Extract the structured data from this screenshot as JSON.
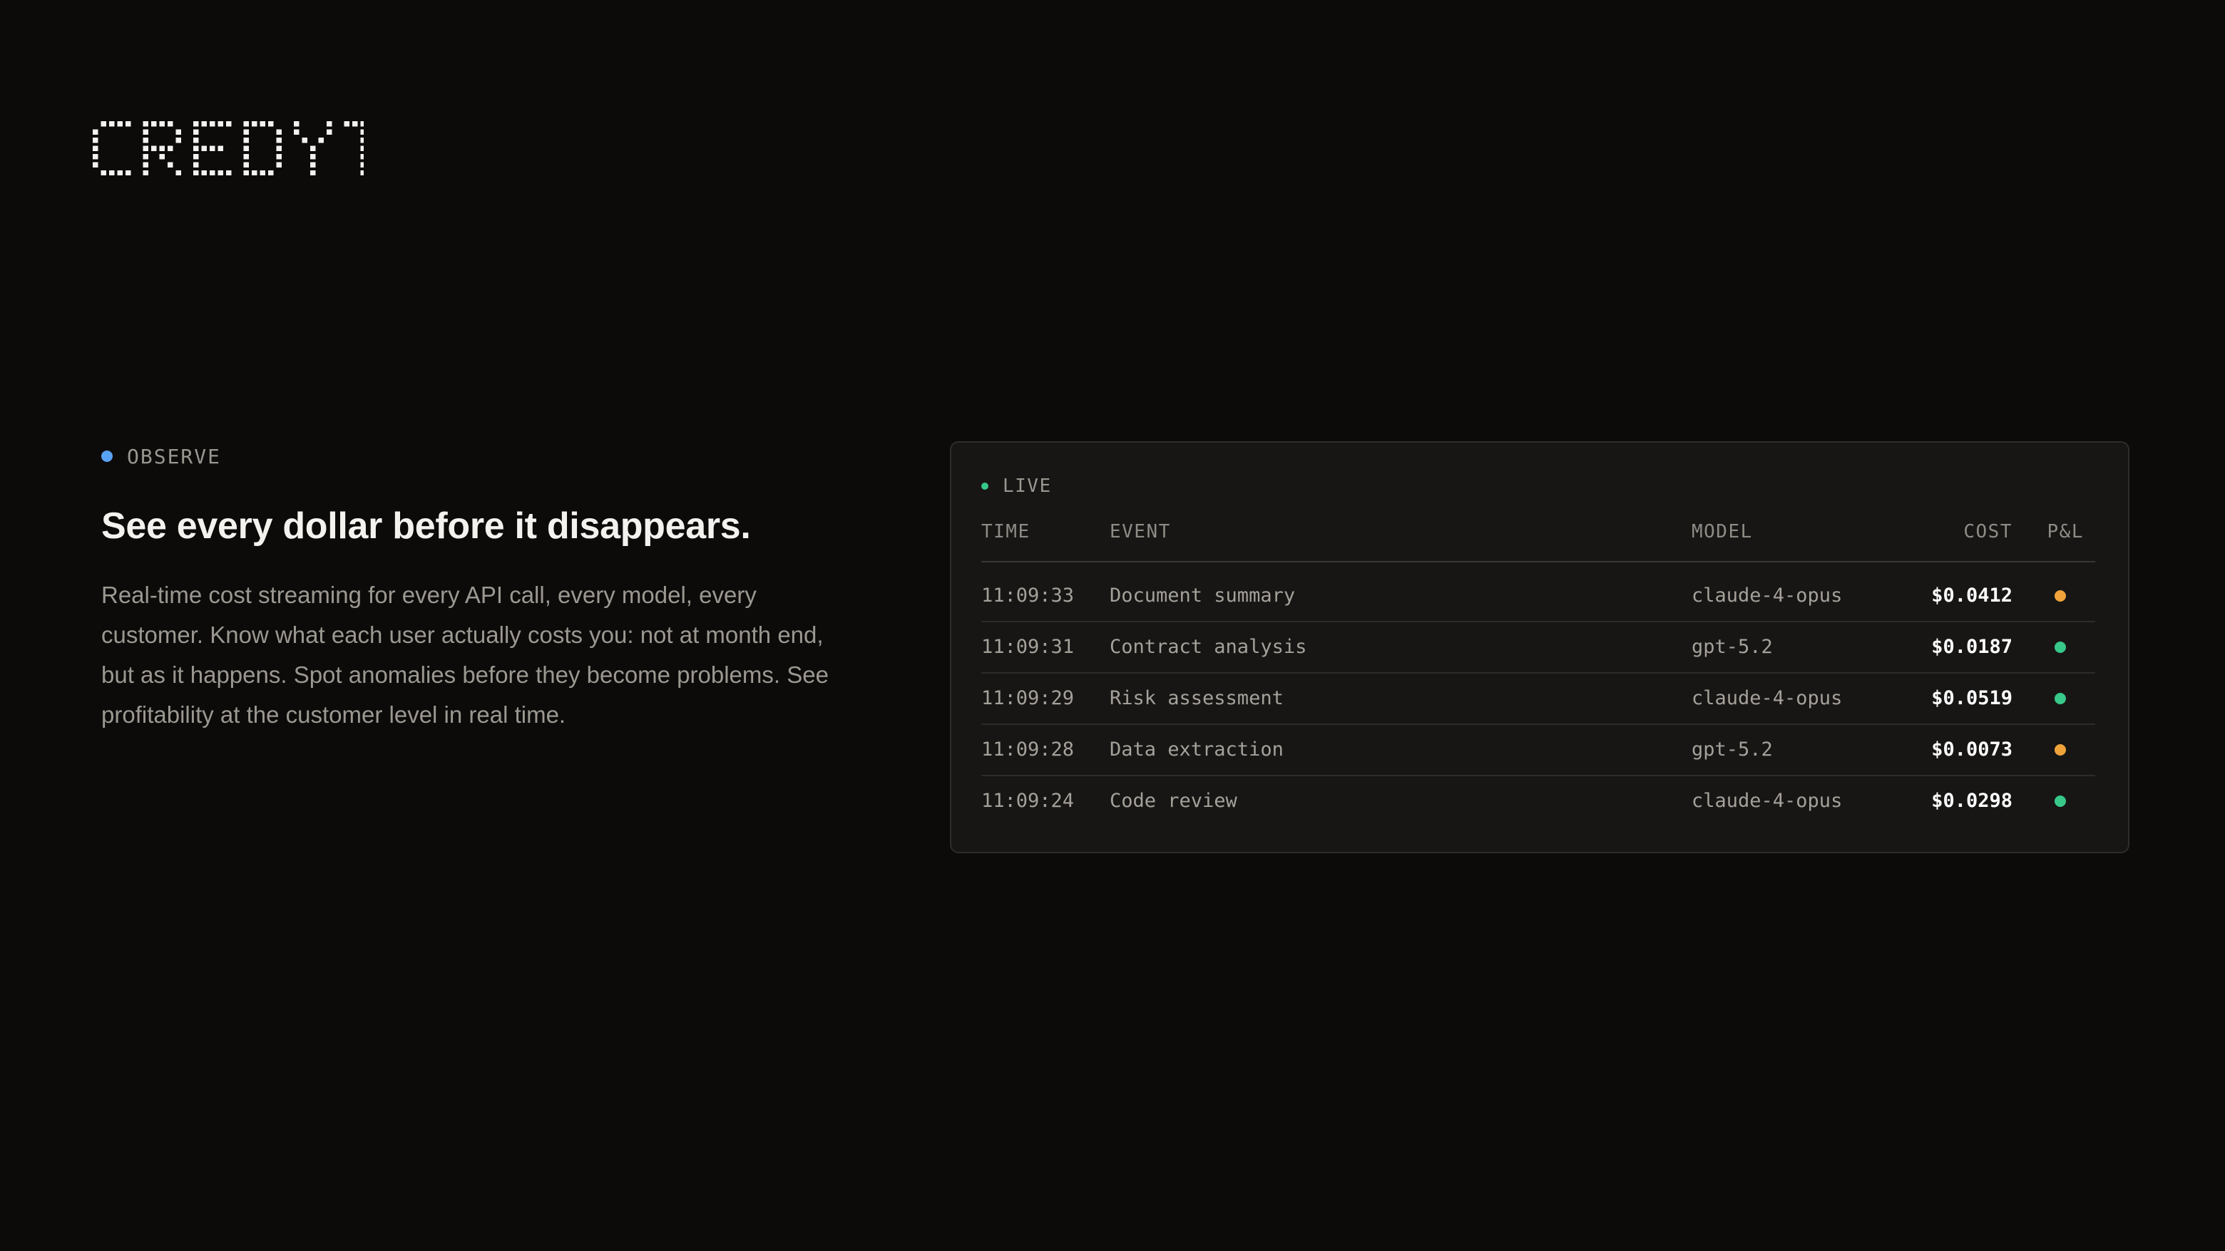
{
  "brand": {
    "logo_text": "CREDYT"
  },
  "section": {
    "eyebrow": "OBSERVE",
    "eyebrow_color": "#5aa2f5",
    "headline": "See every dollar before it disappears.",
    "body": "Real-time cost streaming for every API call, every model, every customer. Know what each user actually costs you: not at month end, but as it happens. Spot anomalies before they become problems. See profitability at the customer level in real time."
  },
  "live_feed": {
    "status_label": "LIVE",
    "status_color": "#38c88a",
    "columns": {
      "time": "TIME",
      "event": "EVENT",
      "model": "MODEL",
      "cost": "COST",
      "pl": "P&L"
    },
    "rows": [
      {
        "time": "11:09:33",
        "event": "Document summary",
        "model": "claude-4-opus",
        "cost": "$0.0412",
        "pl_status": "warning",
        "pl_color": "#f0a33a"
      },
      {
        "time": "11:09:31",
        "event": "Contract analysis",
        "model": "gpt-5.2",
        "cost": "$0.0187",
        "pl_status": "positive",
        "pl_color": "#38c88a"
      },
      {
        "time": "11:09:29",
        "event": "Risk assessment",
        "model": "claude-4-opus",
        "cost": "$0.0519",
        "pl_status": "positive",
        "pl_color": "#38c88a"
      },
      {
        "time": "11:09:28",
        "event": "Data extraction",
        "model": "gpt-5.2",
        "cost": "$0.0073",
        "pl_status": "warning",
        "pl_color": "#f0a33a"
      },
      {
        "time": "11:09:24",
        "event": "Code review",
        "model": "claude-4-opus",
        "cost": "$0.0298",
        "pl_status": "positive",
        "pl_color": "#38c88a"
      }
    ]
  }
}
